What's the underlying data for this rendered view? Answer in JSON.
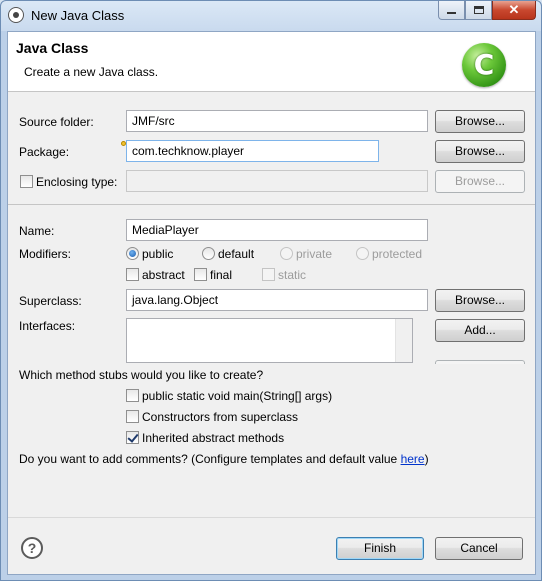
{
  "window": {
    "title": "New Java Class",
    "close_glyph": "✕"
  },
  "header": {
    "title": "Java Class",
    "subtitle": "Create a new Java class.",
    "logo_glyph": "C",
    "logo_icon": "java-class-wizard-icon"
  },
  "source_folder": {
    "label": "Source folder:",
    "value": "JMF/src",
    "browse_label": "Browse..."
  },
  "package": {
    "label": "Package:",
    "value": "com.techknow.player",
    "browse_label": "Browse..."
  },
  "enclosing_type": {
    "label": "Enclosing type:",
    "checked": false,
    "value": "",
    "browse_label": "Browse..."
  },
  "name": {
    "label": "Name:",
    "value": "MediaPlayer"
  },
  "modifiers": {
    "label": "Modifiers:",
    "access": [
      {
        "label": "public",
        "selected": true,
        "enabled": true
      },
      {
        "label": "default",
        "selected": false,
        "enabled": true
      },
      {
        "label": "private",
        "selected": false,
        "enabled": false
      },
      {
        "label": "protected",
        "selected": false,
        "enabled": false
      }
    ],
    "other": [
      {
        "label": "abstract",
        "checked": false,
        "enabled": true
      },
      {
        "label": "final",
        "checked": false,
        "enabled": true
      },
      {
        "label": "static",
        "checked": false,
        "enabled": false
      }
    ]
  },
  "superclass": {
    "label": "Superclass:",
    "value": "java.lang.Object",
    "browse_label": "Browse..."
  },
  "interfaces": {
    "label": "Interfaces:",
    "add_label": "Add..."
  },
  "method_stubs": {
    "question": "Which method stubs would you like to create?",
    "options": [
      {
        "label": "public static void main(String[] args)",
        "checked": false
      },
      {
        "label": "Constructors from superclass",
        "checked": false
      },
      {
        "label": "Inherited abstract methods",
        "checked": true
      }
    ]
  },
  "comments": {
    "question_prefix": "Do you want to add comments? (Configure templates and default value ",
    "link": "here",
    "question_suffix": ")"
  },
  "footer": {
    "help_glyph": "?",
    "finish_label": "Finish",
    "cancel_label": "Cancel"
  },
  "colors": {
    "accent_logo": "#2d8f12",
    "link": "#0033cc",
    "close_button": "#c9482f"
  }
}
